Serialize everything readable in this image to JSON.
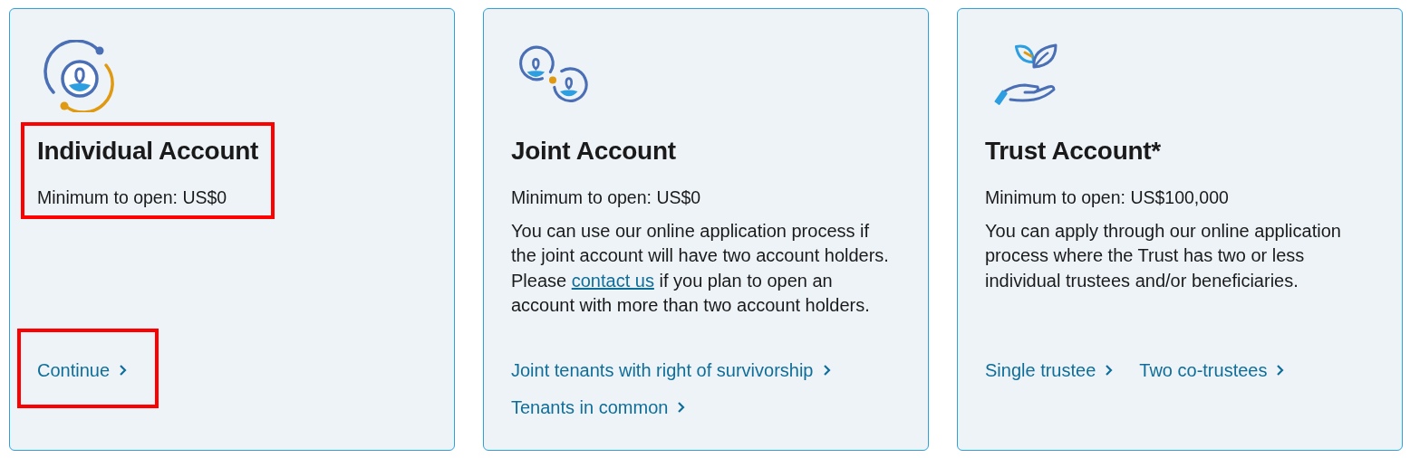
{
  "cards": [
    {
      "kind": "individual",
      "title": "Individual Account",
      "minimum": "Minimum to open: US$0",
      "header_highlighted": true,
      "links": [
        {
          "label": "Continue",
          "highlighted": true
        }
      ]
    },
    {
      "kind": "joint",
      "title": "Joint Account",
      "minimum": "Minimum to open: US$0",
      "description": [
        {
          "kind": "text",
          "text": "You can use our online application process if the joint account will have two account holders. Please "
        },
        {
          "kind": "link",
          "text": "contact us"
        },
        {
          "kind": "text",
          "text": " if you plan to open an account with more than two account holders."
        }
      ],
      "links": [
        {
          "label": "Joint tenants with right of survivorship"
        },
        {
          "label": "Tenants in common"
        }
      ]
    },
    {
      "kind": "trust",
      "title": "Trust Account*",
      "minimum": "Minimum to open: US$100,000",
      "description": [
        {
          "kind": "text",
          "text": "You can apply through our online application process where the Trust has two or less individual trustees and/or beneficiaries."
        }
      ],
      "links": [
        {
          "label": "Single trustee"
        },
        {
          "label": "Two co-trustees"
        }
      ]
    }
  ]
}
